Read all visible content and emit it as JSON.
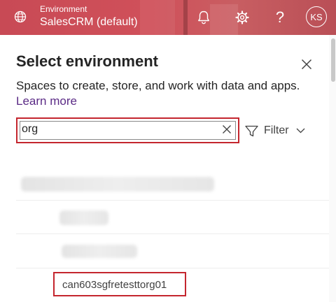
{
  "header": {
    "env_caption": "Environment",
    "env_name": "SalesCRM (default)",
    "avatar_initials": "KS",
    "help_glyph": "?",
    "icons": {
      "environment": "globe-icon",
      "notifications": "bell-icon",
      "settings": "gear-icon",
      "help": "help-icon"
    },
    "colors": {
      "bar": "#c84a55",
      "text": "#ffffff"
    }
  },
  "panel": {
    "title": "Select environment",
    "description": "Spaces to create, store, and work with data and apps.",
    "learn_more": "Learn more",
    "search": {
      "value": "org",
      "placeholder": ""
    },
    "filter_label": "Filter",
    "colors": {
      "link": "#5b2b86",
      "highlight": "#c4262e"
    }
  },
  "environments": [
    {
      "name": "",
      "redacted": true
    },
    {
      "name": "",
      "redacted": true
    },
    {
      "name": "",
      "redacted": true
    },
    {
      "name": "can603sgfretesttorg01",
      "redacted": false,
      "highlighted": true
    }
  ]
}
